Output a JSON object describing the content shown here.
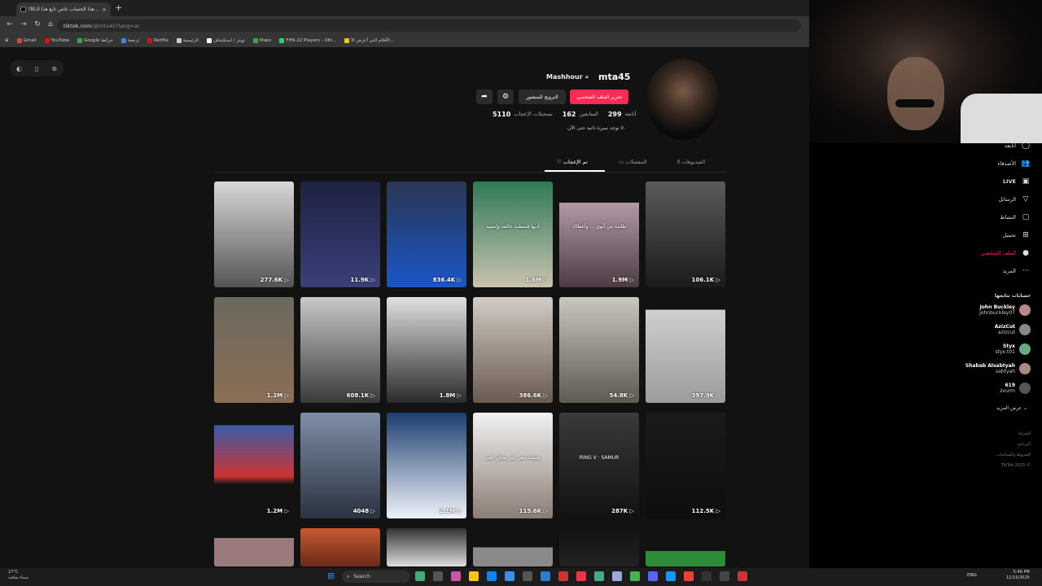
{
  "browser": {
    "tab_title": "(8)هذا الحساب خاص تابع هذا الـ...",
    "tab_close": "×",
    "new_tab": "+",
    "url_host": "tiktok.com",
    "url_path": "/@mta45?lang=ar",
    "bookmarks": [
      {
        "label": "Gmail",
        "color": "#ea4335"
      },
      {
        "label": "YouTube",
        "color": "#ff0000"
      },
      {
        "label": "Google خرائط",
        "color": "#34a853"
      },
      {
        "label": "ترجمة",
        "color": "#4285f4"
      },
      {
        "label": "Netflix",
        "color": "#e50914"
      },
      {
        "label": "الرئيسية",
        "color": "#cccccc"
      },
      {
        "label": "تويتر / استكشاف",
        "color": "#ffffff"
      },
      {
        "label": "Maps",
        "color": "#34a853"
      },
      {
        "label": "FIFA 22 Players - Ulti...",
        "color": "#2ecc71"
      },
      {
        "label": "الأفلام التي أعرض الآ...",
        "color": "#f5c518"
      }
    ]
  },
  "profile": {
    "username": "mta45",
    "display_name": "Mashhour",
    "edit_button": "تحرير الملف الشخصي",
    "promote_button": "الترويج للمنشور",
    "following_count": "299",
    "following_label": "أتابعه",
    "followers_count": "162",
    "followers_label": "المتابعين",
    "likes_count": "5110",
    "likes_label": "تسجيلات الإعجاب",
    "bio": "لا توجد سيرة ذاتية حتى الآن."
  },
  "tabs": {
    "videos": "الفيديوهات",
    "favorites": "المفضلات",
    "liked": "تم الإعجاب"
  },
  "videos": [
    {
      "views": "277.6K",
      "bg": "linear-gradient(#d8d8d8,#555)"
    },
    {
      "views": "11.9K",
      "bg": "linear-gradient(#1d2240,#3a3f7a)"
    },
    {
      "views": "836.4K",
      "bg": "linear-gradient(#2a3552,#1a56c8)"
    },
    {
      "views": "1.6M",
      "bg": "linear-gradient(#2e7a55,#c9c2b0)",
      "caption": "أديها قضطت خالفة وإنسيه"
    },
    {
      "views": "1.9M",
      "bg": "linear-gradient(#121212 20%,#b09aa6 20%,#4c3b44)",
      "caption": "طلبت من أبوي ... وأعطاك"
    },
    {
      "views": "106.1K",
      "bg": "linear-gradient(#5a5a5a,#1a1a1a)"
    },
    {
      "views": "1.2M",
      "bg": "linear-gradient(#6a6a5e,#8c6e55)"
    },
    {
      "views": "608.1K",
      "bg": "linear-gradient(#c8c8c8,#3a3a3a)"
    },
    {
      "views": "1.8M",
      "bg": "linear-gradient(#e0e0e0,#2a2a2a)"
    },
    {
      "views": "386.6K",
      "bg": "linear-gradient(#d0ccc5,#6a5a50)"
    },
    {
      "views": "54.8K",
      "bg": "linear-gradient(#c9c6c0,#5e5a52)"
    },
    {
      "views": "397.9K",
      "bg": "linear-gradient(#121212 12%,#cfcfcf 12%,#9c9c9c)"
    },
    {
      "views": "1.2M",
      "bg": "linear-gradient(#121212 12%,#3b5ca8 12%,#c33 60%,#121212 68%)"
    },
    {
      "views": "4048",
      "bg": "linear-gradient(#7e8ea8,#2a3240)"
    },
    {
      "views": "2.1M",
      "bg": "linear-gradient(#1c3d70,#eef2f8)"
    },
    {
      "views": "115.6K",
      "bg": "linear-gradient(#f2f2f2,#8a7d74)",
      "caption": "وصلت معي بلي بحكي علي"
    },
    {
      "views": "287K",
      "bg": "linear-gradient(#3a3a3a,#111)",
      "caption": "RING V · SAMUR"
    },
    {
      "views": "112.5K",
      "bg": "linear-gradient(#1a1a1a,#0e0e0e)"
    }
  ],
  "video_row4": [
    {
      "bg": "linear-gradient(#121212 25%,#9a7a7a 25%)"
    },
    {
      "bg": "linear-gradient(#c8582e,#6a2a1a)"
    },
    {
      "bg": "linear-gradient(#333,#ddd)"
    },
    {
      "bg": "linear-gradient(#121212 50%,#8a8a8a 50%)"
    },
    {
      "bg": "linear-gradient(#121212,#222)"
    },
    {
      "bg": "linear-gradient(#121212 60%,#2f8a3a 60%)"
    }
  ],
  "sidebar": {
    "items": [
      {
        "label": "أتابعه",
        "icon": "◯"
      },
      {
        "label": "الأصدقاء",
        "icon": "👥"
      },
      {
        "label": "LIVE",
        "icon": "▣"
      },
      {
        "label": "الرسائل",
        "icon": "▽"
      },
      {
        "label": "النشاط",
        "icon": "▢"
      },
      {
        "label": "تحميل",
        "icon": "⊞"
      },
      {
        "label": "الملف الشخصي",
        "icon": "●"
      },
      {
        "label": "المزيد",
        "icon": "···"
      }
    ],
    "following_title": "حسابات تتابعها",
    "accounts": [
      {
        "name": "John Buckley",
        "handle": "johnbuckley07",
        "color": "#b88"
      },
      {
        "name": "AzizCut",
        "handle": "azizcut",
        "color": "#888"
      },
      {
        "name": "Styx",
        "handle": "styx.t01",
        "color": "#6a8"
      },
      {
        "name": "Shabab Alsabtyah",
        "handle": "sabtyah",
        "color": "#a88"
      },
      {
        "name": "619",
        "handle": "zvurm",
        "color": "#555"
      }
    ],
    "see_more": "عرض المزيد",
    "footer": [
      "الشركة",
      "البرنامج",
      "الشروط والسياسات",
      "TikTok 2025 ©"
    ]
  },
  "taskbar": {
    "search": "Search",
    "weather_temp": "27°C",
    "weather_desc": "سماء صافية",
    "lang": "ENG",
    "time": "5:46 PM",
    "date": "11/15/2025"
  }
}
